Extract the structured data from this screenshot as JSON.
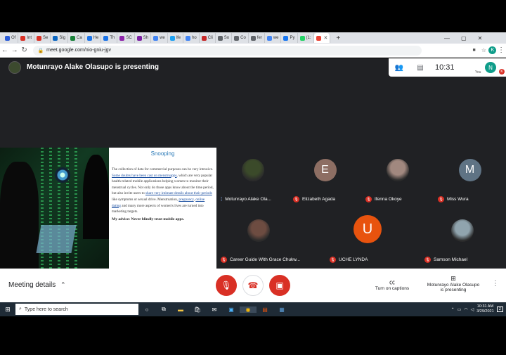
{
  "browser": {
    "tabs": [
      {
        "label": "Of",
        "color": "#2a5bd7"
      },
      {
        "label": "Int",
        "color": "#d93025"
      },
      {
        "label": "Se",
        "color": "#d93025"
      },
      {
        "label": "Sig",
        "color": "#0a66c2"
      },
      {
        "label": "Ca",
        "color": "#188038"
      },
      {
        "label": "He",
        "color": "#1a73e8"
      },
      {
        "label": "Th",
        "color": "#1a73e8"
      },
      {
        "label": "SC",
        "color": "#8e24aa"
      },
      {
        "label": "Sh",
        "color": "#7b1fa2"
      },
      {
        "label": "we",
        "color": "#4285f4"
      },
      {
        "label": "lfe",
        "color": "#1da1f2"
      },
      {
        "label": "ho",
        "color": "#4285f4"
      },
      {
        "label": "Cli",
        "color": "#c62828"
      },
      {
        "label": "So",
        "color": "#5f6368"
      },
      {
        "label": "Co",
        "color": "#5f6368"
      },
      {
        "label": "fer",
        "color": "#5f6368"
      },
      {
        "label": "we",
        "color": "#4285f4"
      },
      {
        "label": "Py",
        "color": "#1877f2"
      },
      {
        "label": "(1:",
        "color": "#25d366"
      },
      {
        "label": "",
        "color": "#ea4335",
        "active": true
      }
    ],
    "new_tab": "+",
    "url": "meet.google.com/nio-gniu-jgv",
    "profile_initial": "K"
  },
  "meet": {
    "presenting_title": "Motunrayo Alake Olasupo is presenting",
    "clock": "10:31",
    "you_initial": "N",
    "you_label": "You",
    "you_badge": "K",
    "slide": {
      "heading": "Snooping",
      "body_segments": [
        {
          "text": "The collection of data for commercial purposes can be very intrusive. ",
          "link": false
        },
        {
          "text": "Some doubts have been cast on menstruapps",
          "link": true
        },
        {
          "text": ", which are very popular health-related mobile applications helping women to monitor their menstrual cycles. Not only do those apps know about the time period, but also invite users to ",
          "link": false
        },
        {
          "text": "share very intimate details about their periods",
          "link": true
        },
        {
          "text": " like symptoms or sexual drive. Menstruation, ",
          "link": false
        },
        {
          "text": "pregnancy",
          "link": true
        },
        {
          "text": ", ",
          "link": false
        },
        {
          "text": "online dating",
          "link": true
        },
        {
          "text": " and many more aspects of women's lives are turned into marketing targets.",
          "link": false
        }
      ],
      "advice": "My advice: Never blindly trust mobile apps."
    },
    "participants": [
      {
        "name": "Motunrayo Alake Ola...",
        "initial": "",
        "bg": "#3b4a2a",
        "muted": false,
        "has_photo": true
      },
      {
        "name": "Elizabeth Agada",
        "initial": "E",
        "bg": "#8d6e63",
        "muted": true
      },
      {
        "name": "Ifenna Okoye",
        "initial": "",
        "bg": "#a1887f",
        "muted": true,
        "has_photo": true
      },
      {
        "name": "Miss Wura",
        "initial": "M",
        "bg": "#5f7384",
        "muted": true
      },
      {
        "name": "Career Guide With Grace Chukw...",
        "initial": "",
        "bg": "#6d4c41",
        "muted": true,
        "has_photo": true
      },
      {
        "name": "UCHE LYNDA",
        "initial": "U",
        "bg": "#e8530e",
        "muted": true
      },
      {
        "name": "Samson Michael",
        "initial": "",
        "bg": "#90a4ae",
        "muted": true,
        "has_photo": true
      }
    ],
    "bottom": {
      "meeting_details": "Meeting details",
      "captions": "Turn on captions",
      "presenting_line1": "Motunrayo Alake Olasupo",
      "presenting_line2": "is presenting"
    }
  },
  "taskbar": {
    "search_placeholder": "Type here to search",
    "time": "10:31 AM",
    "date": "3/29/2021",
    "notification_count": "2"
  },
  "colors": {
    "meet_dark": "#202124",
    "mute_red": "#d93025",
    "slide_heading": "#2a7ab8"
  }
}
